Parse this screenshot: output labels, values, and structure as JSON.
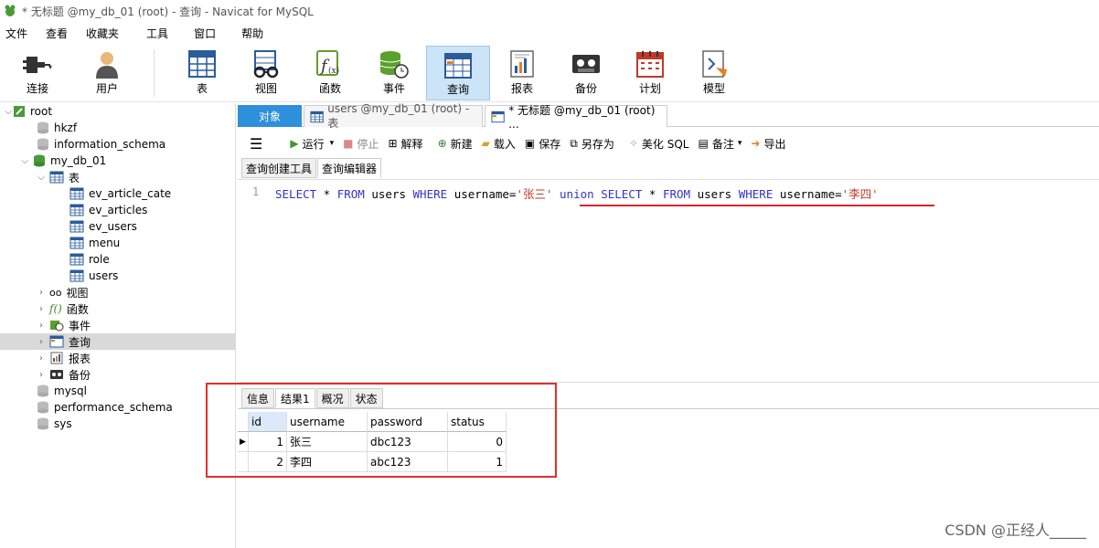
{
  "window": {
    "title": "* 无标题 @my_db_01 (root) - 查询 - Navicat for MySQL"
  },
  "menu": [
    "文件",
    "查看",
    "收藏夹",
    "工具",
    "窗口",
    "帮助"
  ],
  "toolbar": {
    "connect": "连接",
    "user": "用户",
    "table": "表",
    "view": "视图",
    "function": "函数",
    "event": "事件",
    "query": "查询",
    "report": "报表",
    "backup": "备份",
    "schedule": "计划",
    "model": "模型"
  },
  "tree": {
    "root": "root",
    "dbs_top": [
      "hkzf",
      "information_schema"
    ],
    "my_db": "my_db_01",
    "tables_label": "表",
    "tables": [
      "ev_article_cate",
      "ev_articles",
      "ev_users",
      "menu",
      "role",
      "users"
    ],
    "groups": [
      "视图",
      "函数",
      "事件",
      "查询",
      "报表",
      "备份"
    ],
    "dbs_bottom": [
      "mysql",
      "performance_schema",
      "sys"
    ]
  },
  "tabs": {
    "objects": "对象",
    "users_tab": "users @my_db_01 (root) - 表",
    "query_tab": "* 无标题 @my_db_01 (root) ..."
  },
  "query_toolbar": {
    "run": "运行",
    "stop": "停止",
    "explain": "解释",
    "new": "新建",
    "load": "载入",
    "save": "保存",
    "save_as": "另存为",
    "beautify": "美化 SQL",
    "comment": "备注",
    "export": "导出"
  },
  "subtabs": {
    "builder": "查询创建工具",
    "editor": "查询编辑器"
  },
  "editor": {
    "line_no": "1",
    "sql": {
      "p1": "SELECT",
      "p2": " * ",
      "p3": "FROM",
      "p4": " users ",
      "p5": "WHERE",
      "p6": " username=",
      "s1": "'张三'",
      "p7": " ",
      "p8": "union",
      "p9": " ",
      "p10": "SELECT",
      "p11": " * ",
      "p12": "FROM",
      "p13": " users ",
      "p14": "WHERE",
      "p15": " username=",
      "s2": "'李四'"
    }
  },
  "result_tabs": [
    "信息",
    "结果1",
    "概况",
    "状态"
  ],
  "result": {
    "columns": [
      "id",
      "username",
      "password",
      "status"
    ],
    "rows": [
      [
        "1",
        "张三",
        "dbc123",
        "0"
      ],
      [
        "2",
        "李四",
        "abc123",
        "1"
      ]
    ]
  },
  "watermark": "CSDN @正经人_____"
}
